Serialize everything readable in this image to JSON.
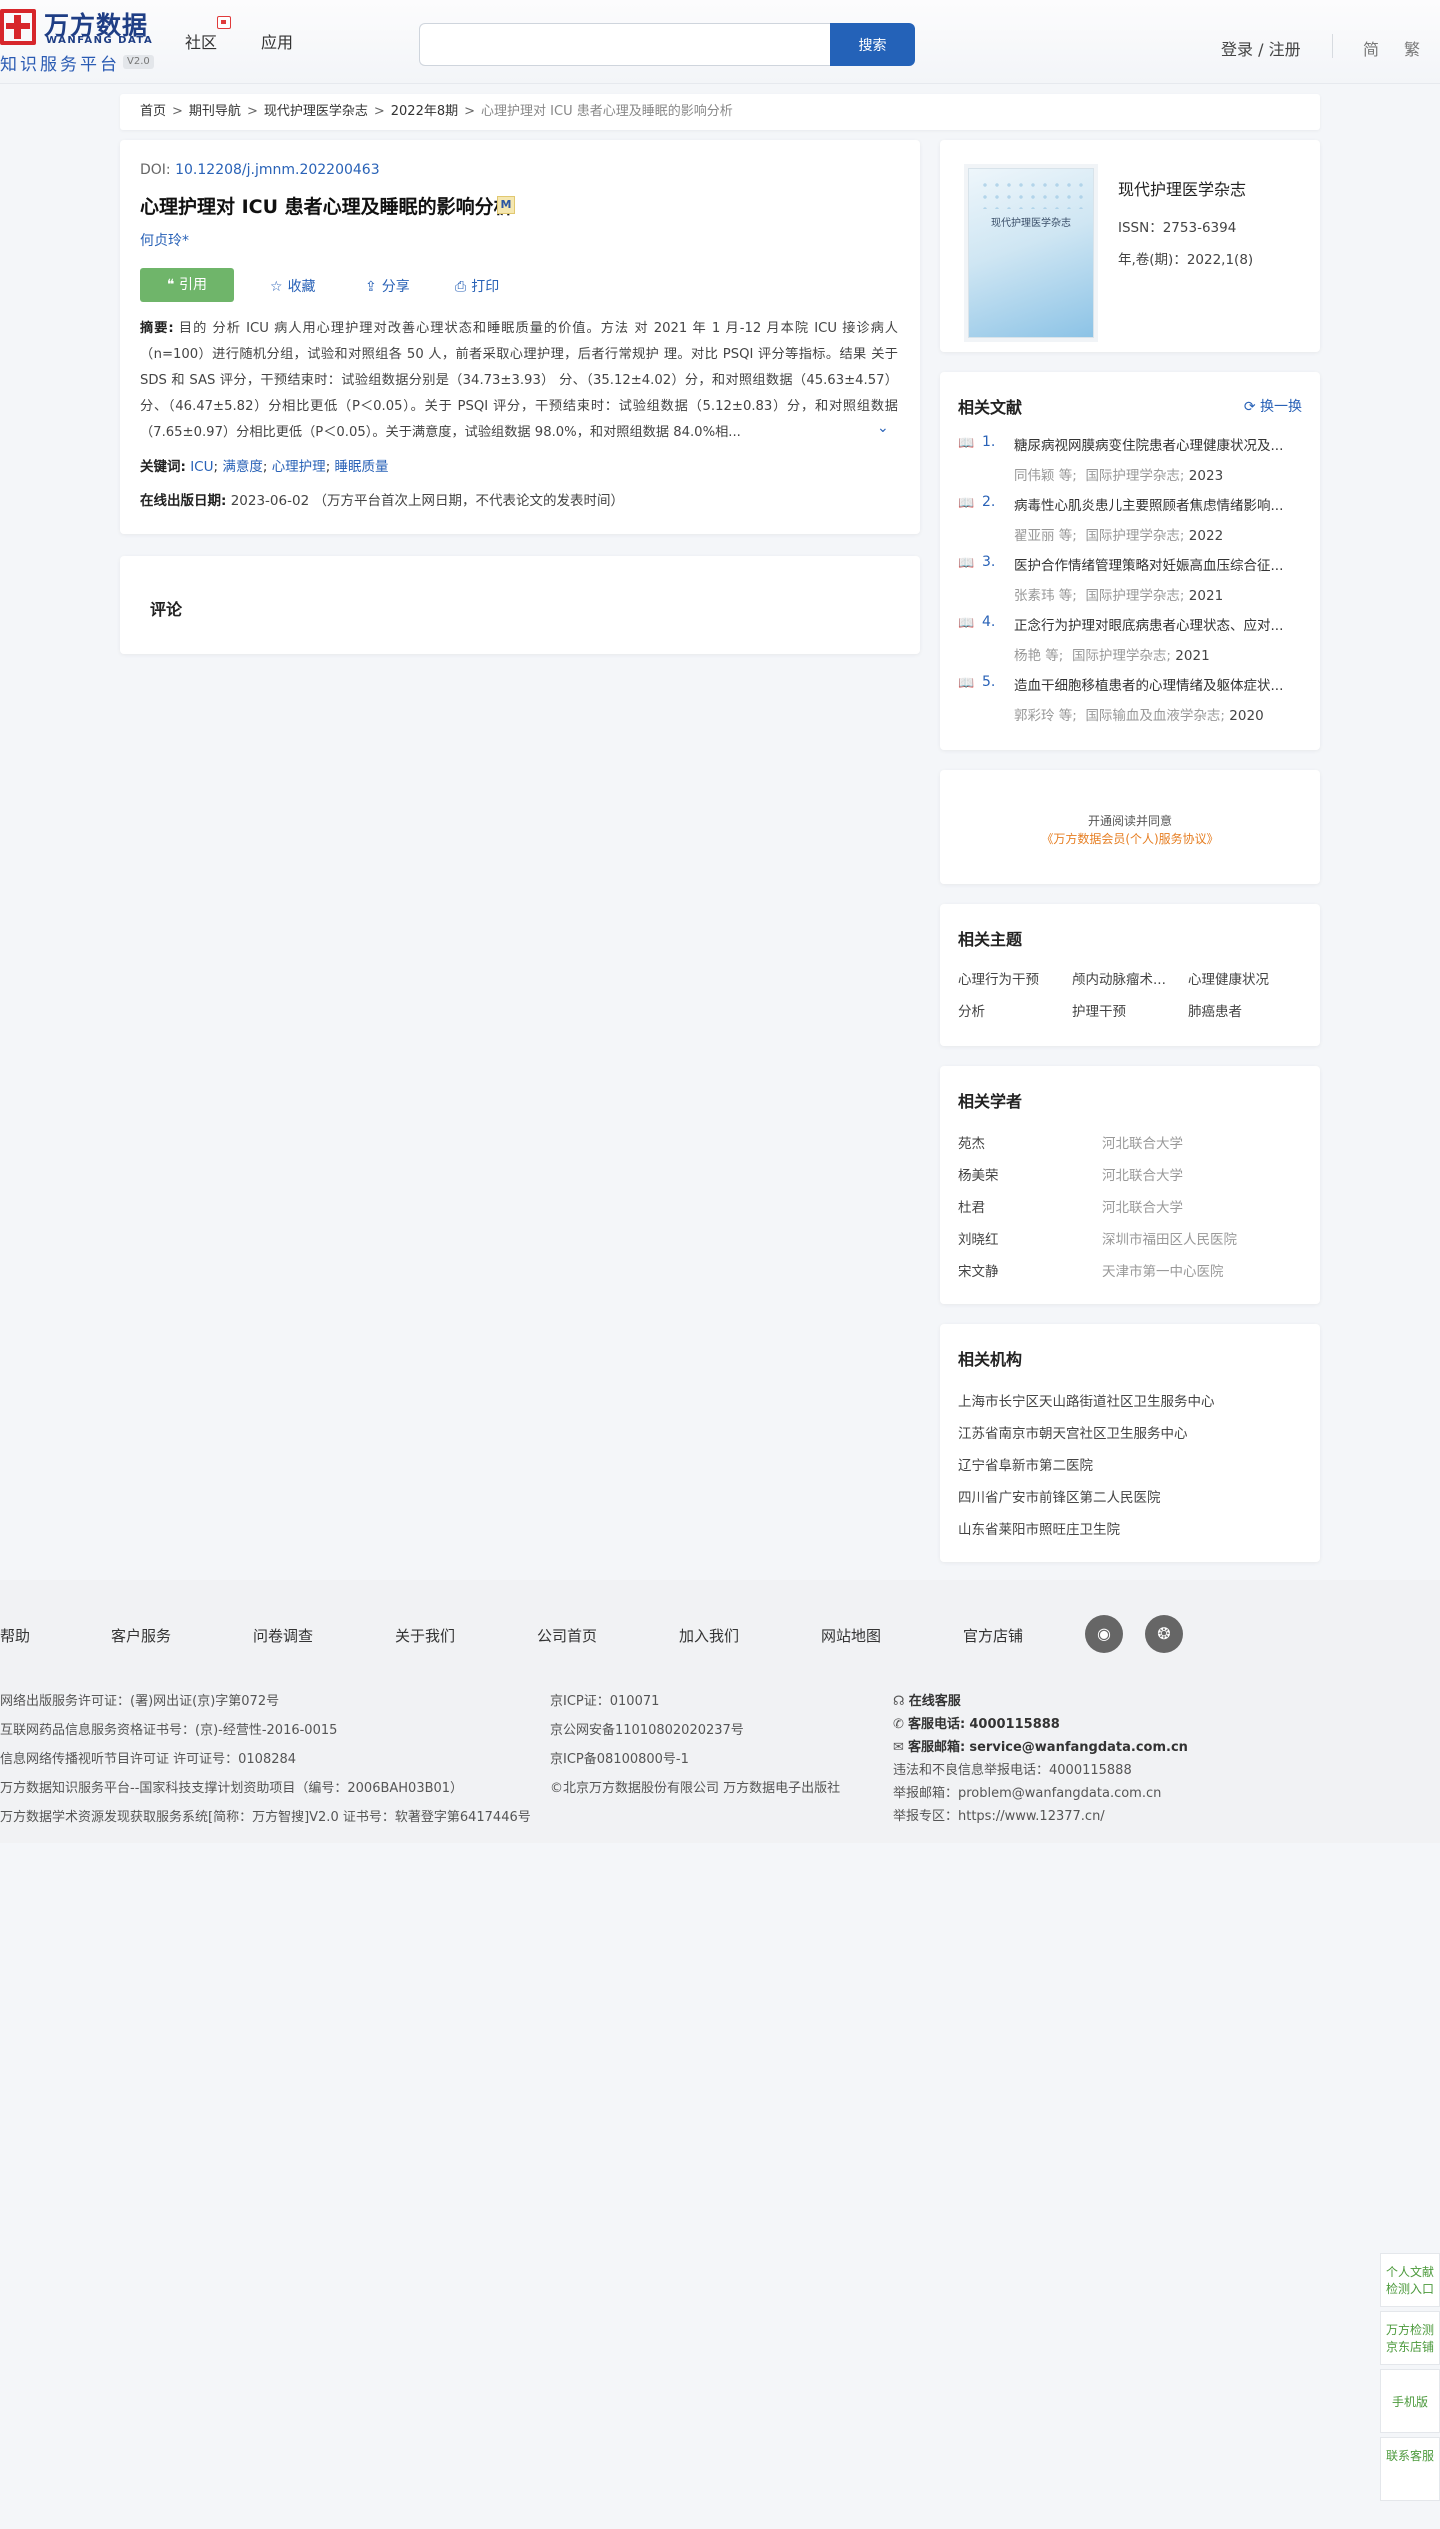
{
  "header": {
    "logo_cn": "万方数据",
    "logo_en": "WANFANG DATA",
    "logo_sub": "知识服务平台",
    "logo_version": "V2.0",
    "nav": [
      "社区",
      "应用"
    ],
    "search_placeholder": "",
    "search_button": "搜索",
    "login": "登录 / 注册",
    "lang_simplified": "简",
    "lang_traditional": "繁"
  },
  "breadcrumb": {
    "items": [
      "首页",
      "期刊导航",
      "现代护理医学杂志",
      "2022年8期"
    ],
    "current": "心理护理对 ICU 患者心理及睡眠的影响分析",
    "separator": ">"
  },
  "article": {
    "doi_label": "DOI:",
    "doi": "10.12208/j.jmnm.202200463",
    "title": "心理护理对 ICU 患者心理及睡眠的影响分析",
    "title_badge": "M",
    "author": "何贞玲*",
    "actions": {
      "cite": "引用",
      "collect": "收藏",
      "share": "分享",
      "print": "打印"
    },
    "abstract_label": "摘要:",
    "abstract": "目的 分析 ICU 病人用心理护理对改善心理状态和睡眠质量的价值。方法 对 2021 年 1 月-12 月本院 ICU 接诊病人（n=100）进行随机分组，试验和对照组各 50 人，前者采取心理护理，后者行常规护 理。对比 PSQI 评分等指标。结果 关于 SDS 和 SAS 评分，干预结束时：试验组数据分别是（34.73±3.93） 分、（35.12±4.02）分，和对照组数据（45.63±4.57）分、（46.47±5.82）分相比更低（P＜0.05）。关于 PSQI 评分，干预结束时：试验组数据（5.12±0.83）分，和对照组数据（7.65±0.97）分相比更低（P＜0.05）。关于满意度，试验组数据 98.0%，和对照组数据 84.0%相...",
    "keywords_label": "关键词:",
    "keywords": [
      "ICU",
      "满意度",
      "心理护理",
      "睡眠质量"
    ],
    "pubdate_label": "在线出版日期:",
    "pubdate": "2023-06-02",
    "pubdate_note": "（万方平台首次上网日期，不代表论文的发表时间）"
  },
  "comment": {
    "title": "评论"
  },
  "journal": {
    "cover_text": "现代护理医学杂志",
    "name": "现代护理医学杂志",
    "issn": "ISSN：2753-6394",
    "volume": "年,卷(期)：2022,1(8)"
  },
  "related_docs": {
    "title": "相关文献",
    "refresh": "换一换",
    "items": [
      {
        "num": "1.",
        "title": "糖尿病视网膜病变住院患者心理健康状况及...",
        "authors": "同伟颖 等;",
        "journal": "国际护理学杂志;",
        "year": "2023"
      },
      {
        "num": "2.",
        "title": "病毒性心肌炎患儿主要照顾者焦虑情绪影响...",
        "authors": "翟亚丽 等;",
        "journal": "国际护理学杂志;",
        "year": "2022"
      },
      {
        "num": "3.",
        "title": "医护合作情绪管理策略对妊娠高血压综合征...",
        "authors": "张素玮 等;",
        "journal": "国际护理学杂志;",
        "year": "2021"
      },
      {
        "num": "4.",
        "title": "正念行为护理对眼底病患者心理状态、应对...",
        "authors": "杨艳 等;",
        "journal": "国际护理学杂志;",
        "year": "2021"
      },
      {
        "num": "5.",
        "title": "造血干细胞移植患者的心理情绪及躯体症状...",
        "authors": "郭彩玲 等;",
        "journal": "国际输血及血液学杂志;",
        "year": "2020"
      }
    ]
  },
  "notice": {
    "line1": "开通阅读并同意",
    "line2": "《万方数据会员(个人)服务协议》"
  },
  "related_topics": {
    "title": "相关主题",
    "items": [
      "心理行为干预",
      "颅内动脉瘤术...",
      "心理健康状况",
      "分析",
      "护理干预",
      "肺癌患者"
    ]
  },
  "related_scholars": {
    "title": "相关学者",
    "items": [
      {
        "name": "苑杰",
        "org": "河北联合大学"
      },
      {
        "name": "杨美荣",
        "org": "河北联合大学"
      },
      {
        "name": "杜君",
        "org": "河北联合大学"
      },
      {
        "name": "刘晓红",
        "org": "深圳市福田区人民医院"
      },
      {
        "name": "宋文静",
        "org": "天津市第一中心医院"
      }
    ]
  },
  "related_orgs": {
    "title": "相关机构",
    "items": [
      "上海市长宁区天山路街道社区卫生服务中心",
      "江苏省南京市朝天宫社区卫生服务中心",
      "辽宁省阜新市第二医院",
      "四川省广安市前锋区第二人民医院",
      "山东省莱阳市照旺庄卫生院"
    ]
  },
  "footer": {
    "links": [
      "帮助",
      "客户服务",
      "问卷调查",
      "关于我们",
      "公司首页",
      "加入我们",
      "网站地图",
      "官方店铺"
    ],
    "social": [
      "weibo-icon",
      "wechat-icon"
    ],
    "col1": [
      "网络出版服务许可证：(署)网出证(京)字第072号",
      "互联网药品信息服务资格证书号：(京)-经营性-2016-0015",
      "信息网络传播视听节目许可证 许可证号：0108284",
      "万方数据知识服务平台--国家科技支撑计划资助项目（编号：2006BAH03B01）",
      "万方数据学术资源发现获取服务系统[简称：万方智搜]V2.0 证书号：软著登字第6417446号"
    ],
    "col2": [
      "京ICP证：010071",
      "京公网安备11010802020237号",
      "京ICP备08100800号-1",
      "©北京万方数据股份有限公司 万方数据电子出版社"
    ],
    "online_service": "在线客服",
    "phone_label": "客服电话:",
    "phone": "4000115888",
    "email_label": "客服邮箱:",
    "email": "service@wanfangdata.com.cn",
    "report_phone": "违法和不良信息举报电话：4000115888",
    "report_email": "举报邮箱：problem@wanfangdata.com.cn",
    "report_site": "举报专区：https://www.12377.cn/"
  },
  "floating": {
    "item1": "个人文献检测入口",
    "item2": "万方检测京东店铺",
    "item3": "手机版",
    "item4": "联系客服"
  },
  "colors": {
    "brand_blue": "#2462b8",
    "link_blue": "#2962b7",
    "cite_green": "#6fb56a",
    "logo_red": "#d7262b",
    "notice_orange": "#e67e22"
  }
}
